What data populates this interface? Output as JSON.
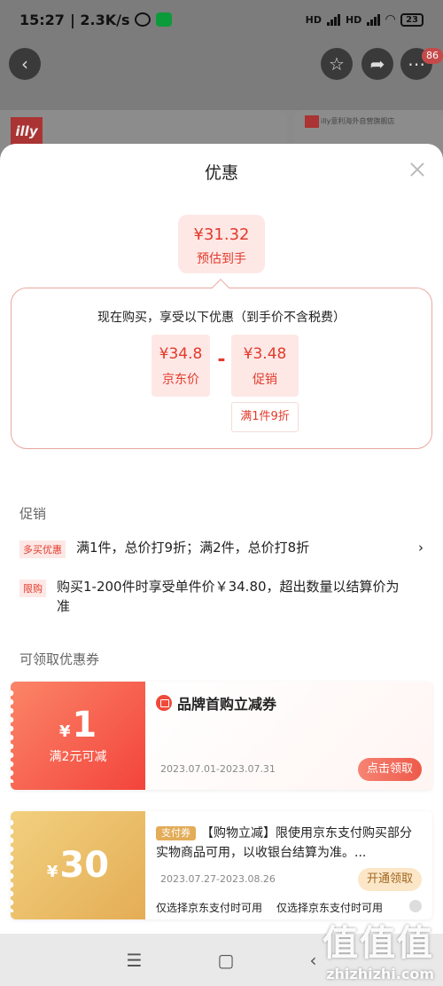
{
  "status_bar": {
    "time": "15:27",
    "speed": "| 2.3K/s",
    "network": "HD",
    "battery": "23"
  },
  "background_page": {
    "badge_count": "86",
    "store_text": "illy意利海外自营旗舰店",
    "logo_text": "illy"
  },
  "sheet": {
    "title": "优惠",
    "estimate": {
      "price": "¥31.32",
      "label": "预估到手"
    },
    "discount_intro": "现在购买，享受以下优惠（到手价不含税费）",
    "jd_price": {
      "value": "¥34.8",
      "label": "京东价"
    },
    "promo_price": {
      "value": "¥3.48",
      "label": "促销",
      "rule": "满1件9折"
    },
    "minus_sign": "-",
    "promo_section": {
      "title": "促销",
      "items": [
        {
          "tag": "多买优惠",
          "text": "满1件，总价打9折；满2件，总价打8折",
          "arrow": "›"
        },
        {
          "tag": "限购",
          "text": "购买1-200件时享受单件价￥34.80，超出数量以结算价为准"
        }
      ]
    },
    "coupon_section": {
      "title": "可领取优惠券",
      "coupons": [
        {
          "currency": "¥",
          "amount": "1",
          "condition": "满2元可减",
          "title": "品牌首购立减券",
          "dates": "2023.07.01-2023.07.31",
          "button": "点击领取"
        },
        {
          "currency": "¥",
          "amount": "30",
          "tag": "支付券",
          "description": "【购物立减】限使用京东支付购买部分实物商品可用，以收银台结算为准。...",
          "dates": "2023.07.27-2023.08.26",
          "button": "开通领取",
          "options": [
            "仅选择京东支付时可用",
            "仅选择京东支付时可用"
          ]
        }
      ]
    }
  },
  "nav_bar": {
    "menu": "☰",
    "home": "▢",
    "back": "‹"
  },
  "watermark": {
    "line1": "值值值",
    "line2": "zhizhizhi.com"
  },
  "colors": {
    "accent_red": "#e33b2c",
    "gold": "#e4ad55"
  }
}
